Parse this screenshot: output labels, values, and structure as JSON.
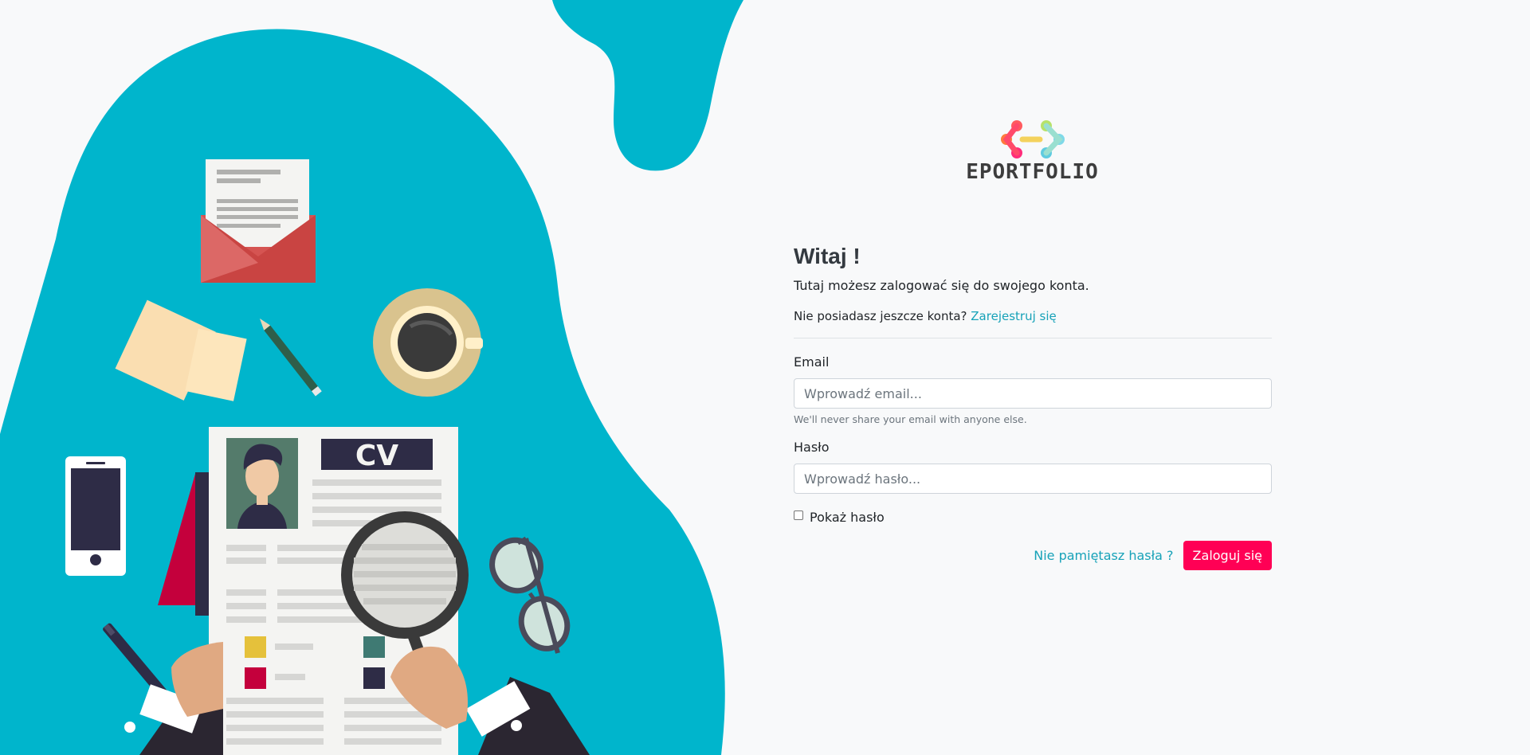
{
  "brand": {
    "name": "EPORTFOLIO"
  },
  "illustration": {
    "cv_heading": "CV"
  },
  "login": {
    "title": "Witaj !",
    "subtitle": "Tutaj możesz zalogować się do swojego konta.",
    "register_prompt": "Nie posiadasz jeszcze konta?",
    "register_link": "Zarejestruj się",
    "email_label": "Email",
    "email_placeholder": "Wprowadź email...",
    "email_value": "",
    "email_help": "We'll never share your email with anyone else.",
    "password_label": "Hasło",
    "password_placeholder": "Wprowadź hasło...",
    "password_value": "",
    "show_password_label": "Pokaż hasło",
    "show_password_checked": false,
    "forgot_link": "Nie pamiętasz hasła ?",
    "submit_label": "Zaloguj się"
  },
  "colors": {
    "accent_teal": "#17a2b8",
    "blob": "#00b5cc",
    "primary_button": "#ff0055",
    "background": "#f8f9fa"
  },
  "icons": [
    "envelope-icon",
    "coffee-cup-icon",
    "pencil-icon",
    "phone-icon",
    "magnifier-icon",
    "glasses-icon",
    "logo-mark-icon"
  ]
}
